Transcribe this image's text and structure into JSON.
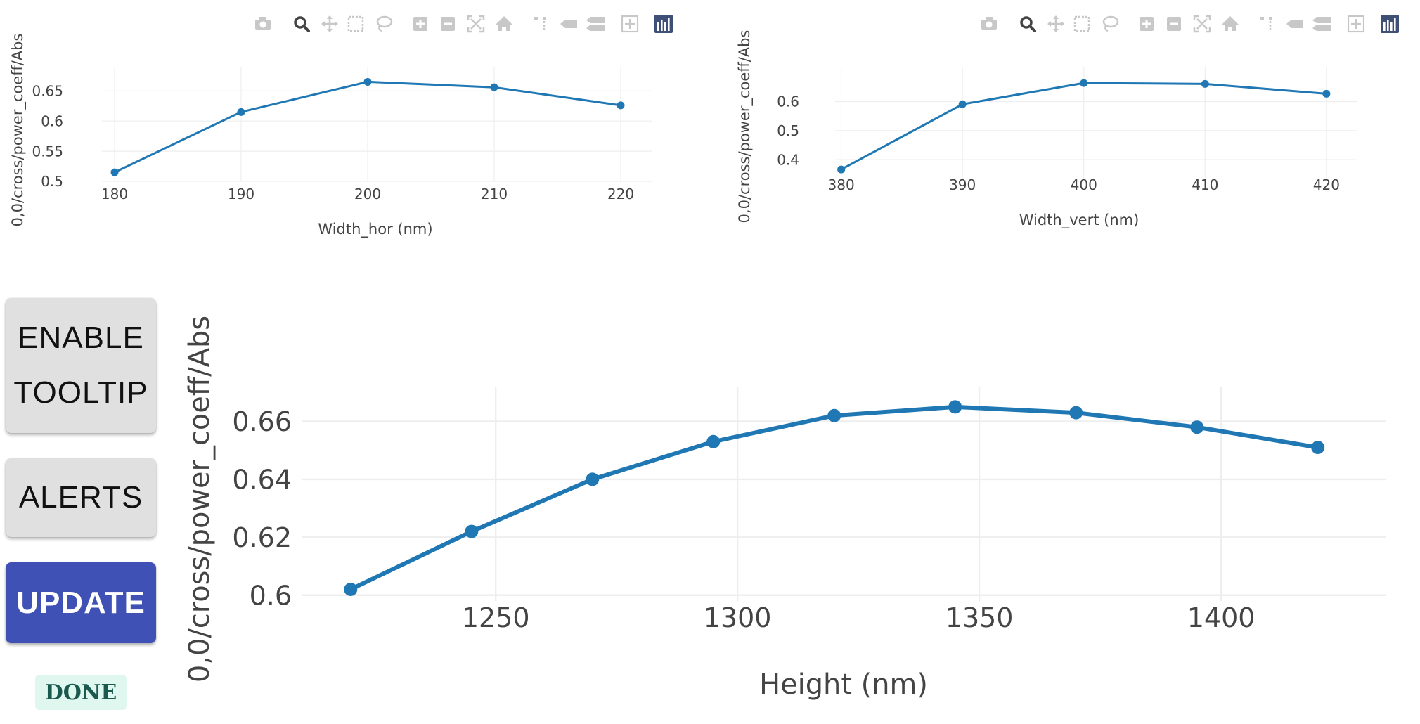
{
  "colors": {
    "series": "#1f77b4",
    "grid": "#eeeeee",
    "axis_text": "#444444",
    "icon_default": "#c8c8c8",
    "icon_active": "#444444",
    "plotly_logo": "#3f4f75",
    "button_bg": "#e0e0e0",
    "update_bg": "#3f51b5",
    "done_bg": "#dff7ef",
    "done_text": "#1a5a4e"
  },
  "modebar_icons": [
    "camera-icon",
    "zoom-icon",
    "pan-icon",
    "box-select-icon",
    "lasso-icon",
    "zoom-in-icon",
    "zoom-out-icon",
    "autoscale-icon",
    "reset-axes-icon",
    "toggle-spike-lines-icon",
    "show-closest-data-icon",
    "compare-data-icon",
    "toggle-crosshair-icon",
    "plotly-logo-icon"
  ],
  "buttons": {
    "tooltip_line1": "ENABLE",
    "tooltip_line2": "TOOLTIP",
    "alerts": "ALERTS",
    "update": "UPDATE"
  },
  "status": "DONE",
  "chart_data": [
    {
      "type": "line",
      "xlabel": "Width_hor (nm)",
      "ylabel": "0,0/cross/power_coeff/Abs",
      "x": [
        180,
        190,
        200,
        210,
        220
      ],
      "y": [
        0.515,
        0.615,
        0.665,
        0.656,
        0.626
      ],
      "xticks": [
        "180",
        "190",
        "200",
        "210",
        "220"
      ],
      "yticks": [
        "0.5",
        "0.55",
        "0.6",
        "0.65"
      ],
      "xlim": [
        179,
        222.5
      ],
      "ylim": [
        0.5,
        0.69
      ],
      "grid": true
    },
    {
      "type": "line",
      "xlabel": "Width_vert (nm)",
      "ylabel": "0,0/cross/power_coeff/Abs",
      "x": [
        380,
        390,
        400,
        410,
        420
      ],
      "y": [
        0.366,
        0.591,
        0.664,
        0.661,
        0.627
      ],
      "xticks": [
        "380",
        "390",
        "400",
        "410",
        "420"
      ],
      "yticks": [
        "0.4",
        "0.5",
        "0.6"
      ],
      "xlim": [
        379.5,
        422.5
      ],
      "ylim": [
        0.33,
        0.72
      ],
      "grid": true
    },
    {
      "type": "line",
      "xlabel": "Height (nm)",
      "ylabel": "0,0/cross/power_coeff/Abs",
      "x": [
        1220,
        1245,
        1270,
        1295,
        1320,
        1345,
        1370,
        1395,
        1420
      ],
      "y": [
        0.602,
        0.622,
        0.64,
        0.653,
        0.662,
        0.665,
        0.663,
        0.658,
        0.651
      ],
      "xticks": [
        "1250",
        "1300",
        "1350",
        "1400"
      ],
      "yticks": [
        "0.6",
        "0.62",
        "0.64",
        "0.66"
      ],
      "xlim": [
        1210,
        1434
      ],
      "ylim": [
        0.598,
        0.672
      ],
      "grid": true
    }
  ]
}
